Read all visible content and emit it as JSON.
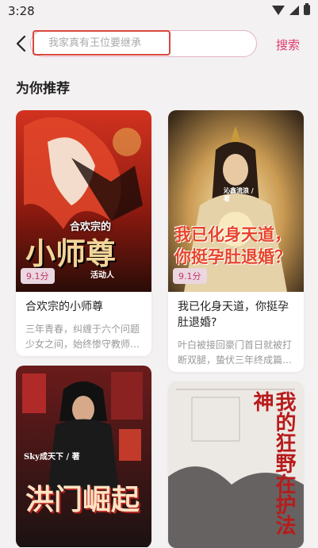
{
  "status": {
    "time": "3:28"
  },
  "search": {
    "placeholder": "我家真有王位要继承",
    "button_label": "搜索"
  },
  "section": {
    "title": "为你推荐"
  },
  "books": [
    {
      "title": "合欢宗的小师尊",
      "rating": "9.1分",
      "desc": "三年青春，纠缠于六个问题少女之间，始终惨守教师…",
      "cover_top": "合欢宗的",
      "cover_main": "小师尊",
      "cover_small": "活动人",
      "cover_colors": [
        "#c8281d",
        "#3a0f0a"
      ]
    },
    {
      "title": "我已化身天道，你挺孕肚退婚?",
      "rating": "9.1分",
      "desc": "叶白被接回豪门首日就被打断双腿，蛰伏三年终成篇…",
      "cover_author": "沁鑫流浪 / 著",
      "cover_main": "我已化身天道，你挺孕肚退婚？",
      "cover_colors": [
        "#d9b26a",
        "#3b2a18"
      ]
    },
    {
      "cover_author": "Sky成天下 / 著",
      "cover_main": "洪门崛起",
      "cover_colors": [
        "#7a1d1d",
        "#1e1414"
      ]
    },
    {
      "cover_main": "我的狂野在护法神",
      "cover_colors": [
        "#e9e6e3",
        "#7a1c1c"
      ]
    }
  ]
}
